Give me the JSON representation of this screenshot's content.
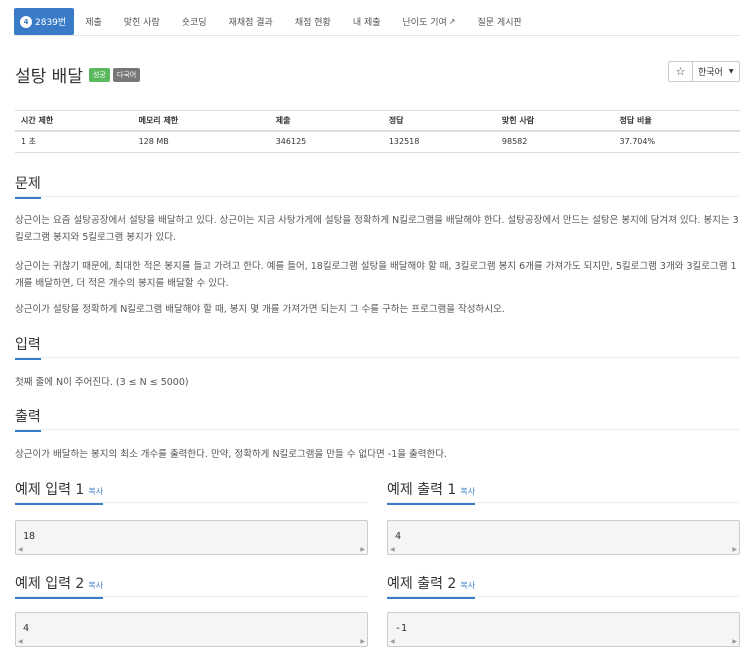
{
  "nav": {
    "active_num": "4",
    "active_label": "2839번",
    "tabs": [
      "제출",
      "맞힌 사람",
      "숏코딩",
      "재채점 결과",
      "채점 현황",
      "내 제출",
      "난이도 기여",
      "질문 게시판"
    ],
    "ext_icon": "external-link-icon"
  },
  "problem": {
    "title": "설탕 배달",
    "badge_success": "성공",
    "badge_lang": "다국어",
    "star": "☆",
    "language": "한국어"
  },
  "info": {
    "headers": [
      "시간 제한",
      "메모리 제한",
      "제출",
      "정답",
      "맞힌 사람",
      "정답 비율"
    ],
    "values": [
      "1 초",
      "128 MB",
      "346125",
      "132518",
      "98582",
      "37.704%"
    ]
  },
  "sections": {
    "problem_h": "문제",
    "problem_p1": "상근이는 요즘 설탕공장에서 설탕을 배달하고 있다. 상근이는 지금 사탕가게에 설탕을 정확하게 N킬로그램을 배달해야 한다. 설탕공장에서 만드는 설탕은 봉지에 담겨져 있다. 봉지는 3킬로그램 봉지와 5킬로그램 봉지가 있다.",
    "problem_p2": "상근이는 귀찮기 때문에, 최대한 적은 봉지를 들고 가려고 한다. 예를 들어, 18킬로그램 설탕을 배달해야 할 때, 3킬로그램 봉지 6개를 가져가도 되지만, 5킬로그램 3개와 3킬로그램 1개를 배달하면, 더 적은 개수의 봉지를 배달할 수 있다.",
    "problem_p3": "상근이가 설탕을 정확하게 N킬로그램 배달해야 할 때, 봉지 몇 개를 가져가면 되는지 그 수를 구하는 프로그램을 작성하시오.",
    "input_h": "입력",
    "input_p": "첫째 줄에 N이 주어진다. (3 ≤ N ≤ 5000)",
    "output_h": "출력",
    "output_p": "상근이가 배달하는 봉지의 최소 개수를 출력한다. 만약, 정확하게 N킬로그램을 만들 수 없다면 -1을 출력한다."
  },
  "samples": {
    "copy_label": "복사",
    "in1_h": "예제 입력 1",
    "out1_h": "예제 출력 1",
    "in1": "18",
    "out1": "4",
    "in2_h": "예제 입력 2",
    "out2_h": "예제 출력 2",
    "in2": "4",
    "out2": "-1"
  }
}
